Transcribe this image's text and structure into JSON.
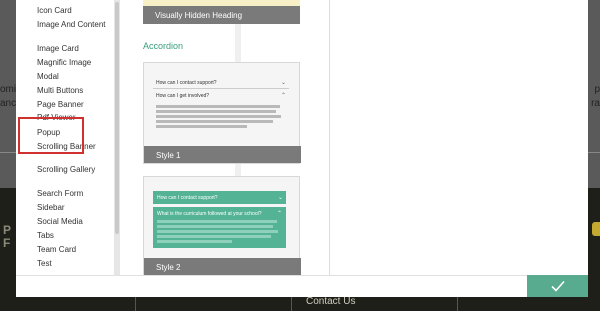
{
  "background": {
    "left_fragments": [
      "omi",
      "anc"
    ],
    "right_fragments": [
      "p",
      "ra"
    ],
    "bottom_left": [
      "P",
      "F"
    ],
    "contact": "Contact Us"
  },
  "sidebar": {
    "items": [
      "Icon Card",
      "Image And Content",
      "Image Card",
      "Magnific Image",
      "Modal",
      "Multi Buttons",
      "Page Banner",
      "Pdf Viewer",
      "Popup",
      "Scrolling Banner",
      "Scrolling Gallery",
      "Search Form",
      "Sidebar",
      "Social Media",
      "Tabs",
      "Team Card",
      "Test"
    ],
    "selected": "Popup"
  },
  "preview": {
    "top_card_caption": "Visually Hidden Heading",
    "section_title": "Accordion",
    "style1": {
      "label": "Style 1",
      "q1": "How can I contact support?",
      "q2": "How can I get involved?"
    },
    "style2": {
      "label": "Style 2",
      "q1": "How can I contact support?",
      "q2": "What is the curriculum followed at your school?"
    }
  },
  "footer": {
    "confirm_icon": "checkmark-icon"
  },
  "colors": {
    "accent": "#58ab8e",
    "highlight_border": "#d0302e",
    "section_title": "#3a9c7d"
  }
}
